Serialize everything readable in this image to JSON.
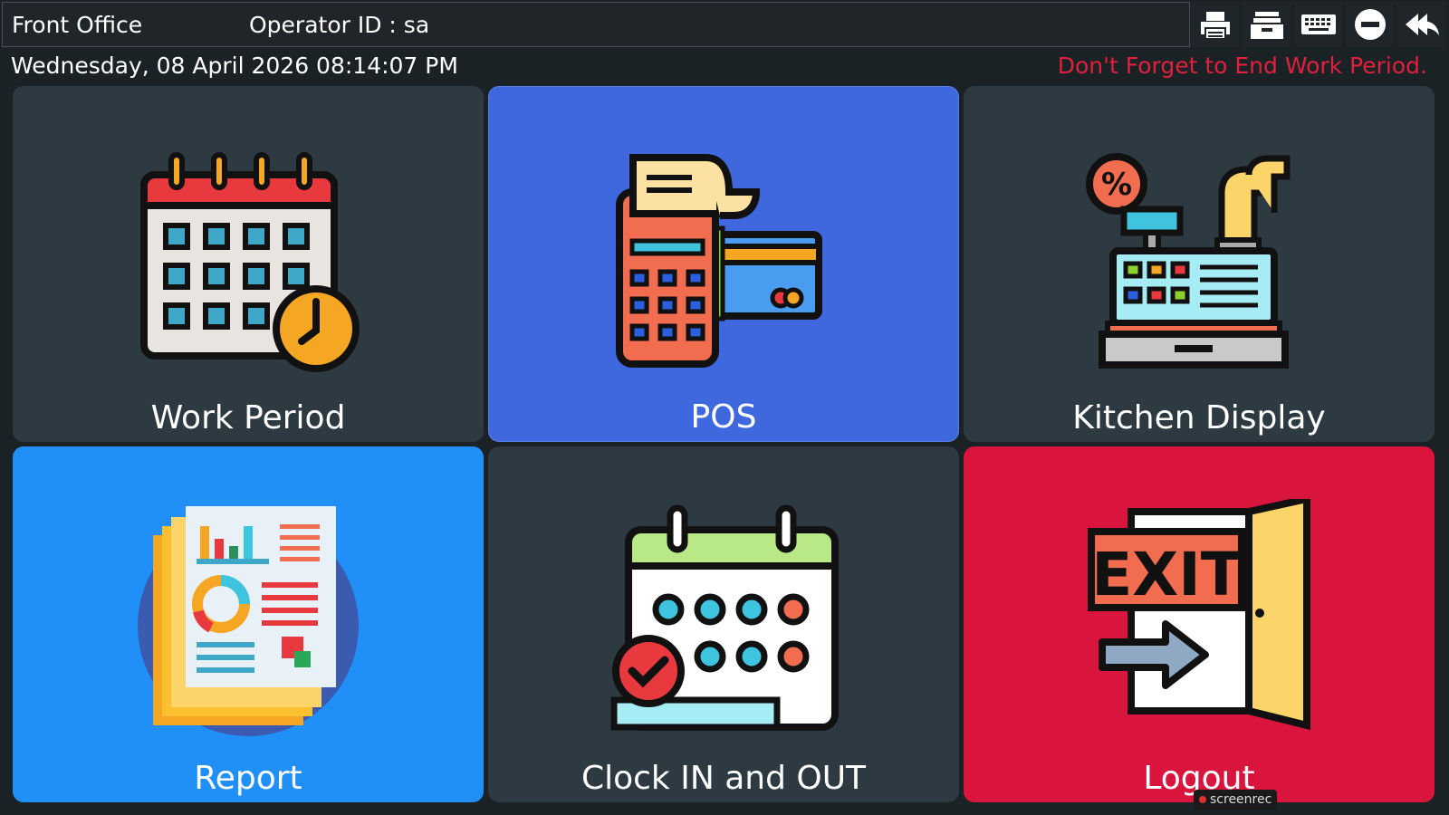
{
  "header": {
    "title": "Front Office",
    "operator": "Operator ID :  sa",
    "datetime": "Wednesday, 08 April 2026 08:14:07 PM",
    "reminder": "Don't Forget to End Work Period."
  },
  "toolbar": [
    {
      "icon": "printer-icon"
    },
    {
      "icon": "cash-drawer-icon"
    },
    {
      "icon": "keyboard-icon"
    },
    {
      "icon": "minimize-icon"
    },
    {
      "icon": "back-icon"
    }
  ],
  "tiles": [
    {
      "label": "Work Period",
      "icon": "calendar-clock-icon",
      "color": "#2e3a42"
    },
    {
      "label": "POS",
      "icon": "pos-terminal-icon",
      "color": "#3f68df"
    },
    {
      "label": "Kitchen Display",
      "icon": "cash-register-icon",
      "color": "#2e3a42"
    },
    {
      "label": "Report",
      "icon": "report-icon",
      "color": "#2090f8"
    },
    {
      "label": "Clock IN and OUT",
      "icon": "calendar-check-icon",
      "color": "#2e3a42"
    },
    {
      "label": "Logout",
      "icon": "exit-door-icon",
      "color": "#d9153d"
    }
  ],
  "watermark": "screenrec",
  "colors": {
    "accent_red": "#e0203c",
    "background": "#1a2226"
  }
}
